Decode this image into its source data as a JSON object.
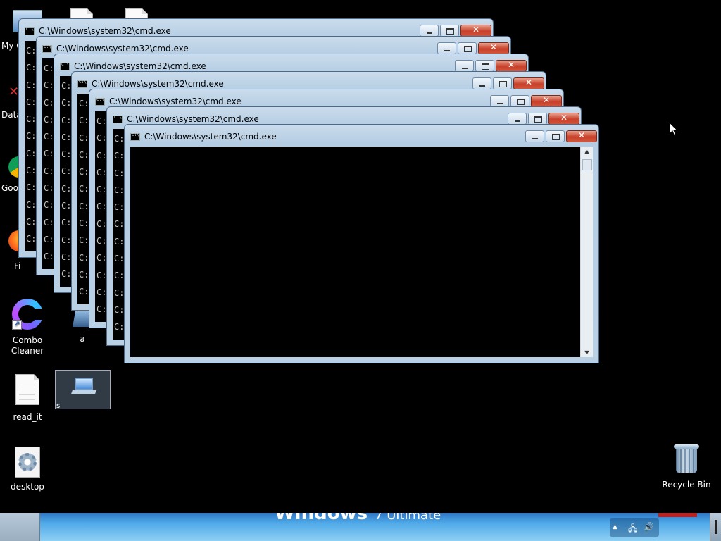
{
  "desktop": {
    "icons": {
      "my_computer": "My C",
      "data": "Data",
      "google": "Goo",
      "firefox": "Firefo",
      "combo_cleaner": "Combo\nCleaner",
      "a": "a",
      "read_it": "read_it",
      "s": "s",
      "desktop_file": "desktop",
      "recycle_bin": "Recycle Bin"
    }
  },
  "windows": [
    {
      "title": "C:\\Windows\\system32\\cmd.exe",
      "lines": [
        "C:",
        "C:",
        "C:",
        "C:",
        "C:",
        "C:",
        "C:",
        "C:",
        "C:",
        "C:",
        "C:",
        "C:",
        "C:"
      ]
    },
    {
      "title": "C:\\Windows\\system32\\cmd.exe",
      "lines": [
        "C:",
        "C:",
        "C:",
        "C:",
        "C:",
        "C:",
        "C:",
        "C:",
        "C:",
        "C:",
        "C:",
        "C:",
        "C:"
      ]
    },
    {
      "title": "C:\\Windows\\system32\\cmd.exe",
      "lines": [
        "C:",
        "C:",
        "C:",
        "C:",
        "C:",
        "C:",
        "C:",
        "C:",
        "C:",
        "C:",
        "C:",
        "C:",
        "C:"
      ]
    },
    {
      "title": "C:\\Windows\\system32\\cmd.exe",
      "lines": [
        "C:",
        "C:",
        "C:",
        "C:",
        "C:",
        "C:",
        "C:",
        "C:",
        "C:",
        "C:",
        "C:",
        "C:",
        "C:"
      ]
    },
    {
      "title": "C:\\Windows\\system32\\cmd.exe",
      "lines": [
        "C:",
        "C:",
        "C:",
        "C:",
        "C:",
        "C:",
        "C:",
        "C:",
        "C:",
        "C:",
        "C:",
        "C:",
        "C:"
      ]
    },
    {
      "title": "C:\\Windows\\system32\\cmd.exe",
      "lines": [
        "C:",
        "C:",
        "C:",
        "C:",
        "C:",
        "C:",
        "C:",
        "C:",
        "C:",
        "C:",
        "C:",
        "C:",
        "C:"
      ]
    },
    {
      "title": "C:\\Windows\\system32\\cmd.exe",
      "lines": []
    }
  ],
  "taskbar": {
    "brand": "Windows",
    "edition": "7 Ultimate",
    "tray_arrow": "▲",
    "network_icon": "network-icon",
    "volume_icon": "volume-icon"
  }
}
